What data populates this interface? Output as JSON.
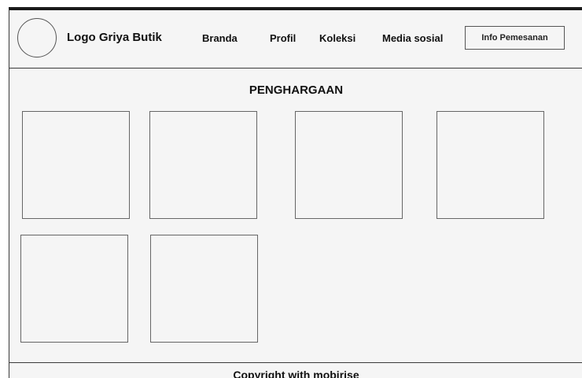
{
  "navbar": {
    "logo_icon": "circle-logo-placeholder",
    "brand": "Logo Griya Butik",
    "links": [
      "Branda",
      "Profil",
      "Koleksi",
      "Media sosial"
    ],
    "order_button": "Info Pemesanan"
  },
  "main": {
    "title": "PENGHARGAAN",
    "award_count": 6
  },
  "footer": {
    "text": "Copyright with mobirise"
  }
}
